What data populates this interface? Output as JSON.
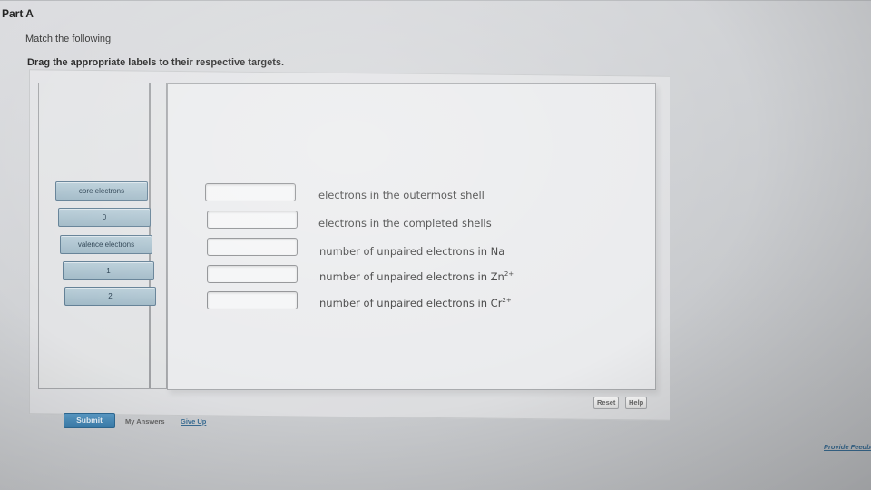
{
  "header": {
    "part_title": "Part A",
    "match_text": "Match the following",
    "instruction": "Drag the appropriate labels to their respective targets."
  },
  "labels": [
    {
      "text": "core electrons"
    },
    {
      "text": "0"
    },
    {
      "text": "valence electrons"
    },
    {
      "text": "1"
    },
    {
      "text": "2"
    }
  ],
  "targets": [
    {
      "text": "electrons in the outermost shell",
      "sup": ""
    },
    {
      "text": "electrons in the completed shells",
      "sup": ""
    },
    {
      "text": "number of unpaired electrons in Na",
      "sup": ""
    },
    {
      "text": "number of unpaired electrons in Zn",
      "sup": "2+"
    },
    {
      "text": "number of unpaired electrons in Cr",
      "sup": "2+"
    }
  ],
  "controls": {
    "reset_label": "Reset",
    "help_label": "Help",
    "submit_label": "Submit",
    "my_answers_label": "My Answers",
    "give_up_label": "Give Up",
    "feedback_label": "Provide Feedback"
  },
  "colors": {
    "label_tile": "#a9c1ce",
    "submit_button": "#4a8cbb",
    "link": "#3a6d94"
  }
}
